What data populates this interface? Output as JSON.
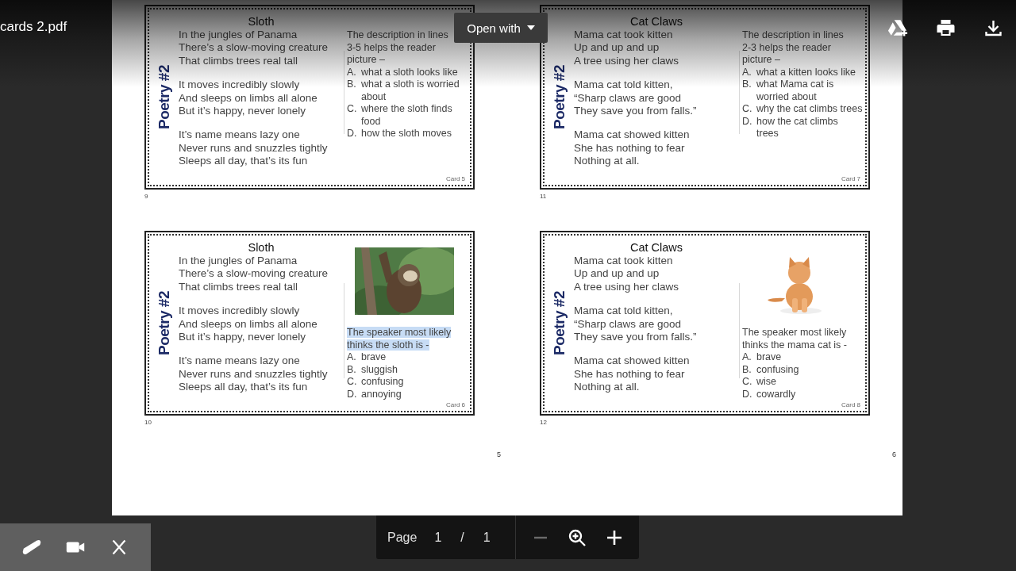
{
  "file_title": "cards 2.pdf",
  "open_with": {
    "label": "Open with"
  },
  "pages": [
    {
      "number": "5",
      "cards": [
        {
          "side_label": "Poetry #2",
          "title": "Sloth",
          "stanzas": [
            [
              "In the jungles of Panama",
              "There’s a slow-moving creature",
              "That climbs trees real tall"
            ],
            [
              "It moves incredibly slowly",
              "And sleeps on limbs all alone",
              "But it’s happy, never lonely"
            ],
            [
              "It’s name means lazy one",
              "Never runs and snuzzles tightly",
              "Sleeps all day, that’s its fun"
            ]
          ],
          "question": "The description in lines 3-5 helps the reader picture –",
          "highlighted": false,
          "options": [
            {
              "letter": "A.",
              "text": "what a sloth looks like"
            },
            {
              "letter": "B.",
              "text": "what a sloth is worried about"
            },
            {
              "letter": "C.",
              "text": "where the sloth finds food"
            },
            {
              "letter": "D.",
              "text": "how the sloth moves"
            }
          ],
          "card_label": "Card 5",
          "sheet_number": "9"
        },
        {
          "side_label": "Poetry #2",
          "title": "Sloth",
          "stanzas": [
            [
              "In the jungles of Panama",
              "There’s a slow-moving creature",
              "That climbs trees real tall"
            ],
            [
              "It moves incredibly slowly",
              "And sleeps on limbs all alone",
              "But it’s happy, never lonely"
            ],
            [
              "It’s name means lazy one",
              "Never runs and snuzzles tightly",
              "Sleeps all day, that’s its fun"
            ]
          ],
          "media": {
            "kind": "picture"
          },
          "question": "The speaker most likely thinks the sloth is -",
          "highlighted": true,
          "options": [
            {
              "letter": "A.",
              "text": "brave"
            },
            {
              "letter": "B.",
              "text": "sluggish"
            },
            {
              "letter": "C.",
              "text": "confusing"
            },
            {
              "letter": "D.",
              "text": "annoying"
            }
          ],
          "card_label": "Card 6",
          "sheet_number": "10"
        }
      ]
    },
    {
      "number": "6",
      "cards": [
        {
          "side_label": "Poetry #2",
          "title": "Cat Claws",
          "stanzas": [
            [
              "Mama cat took kitten",
              "Up and up and up",
              "A tree using her claws"
            ],
            [
              "Mama cat told kitten,",
              "“Sharp claws are good",
              "They save you from falls.”"
            ],
            [
              "Mama cat showed kitten",
              "She has nothing to fear",
              "Nothing at all."
            ]
          ],
          "question": "The description in lines 2-3 helps the reader picture –",
          "highlighted": false,
          "options": [
            {
              "letter": "A.",
              "text": "what a kitten looks like"
            },
            {
              "letter": "B.",
              "text": "what Mama cat is worried about"
            },
            {
              "letter": "C.",
              "text": "why the cat climbs trees"
            },
            {
              "letter": "D.",
              "text": "how the cat climbs trees"
            }
          ],
          "card_label": "Card 7",
          "sheet_number": "11"
        },
        {
          "side_label": "Poetry #2",
          "title": "Cat Claws",
          "stanzas": [
            [
              "Mama cat took kitten",
              "Up and up and up",
              "A tree using her claws"
            ],
            [
              "Mama cat told kitten,",
              "“Sharp claws are good",
              "They save you from falls.”"
            ],
            [
              "Mama cat showed kitten",
              "She has nothing to fear",
              "Nothing at all."
            ]
          ],
          "media": {
            "kind": "picture"
          },
          "question": "The speaker most likely thinks the mama cat is -",
          "highlighted": false,
          "options": [
            {
              "letter": "A.",
              "text": "brave"
            },
            {
              "letter": "B.",
              "text": "confusing"
            },
            {
              "letter": "C.",
              "text": "wise"
            },
            {
              "letter": "D.",
              "text": "cowardly"
            }
          ],
          "card_label": "Card 8",
          "sheet_number": "12"
        }
      ]
    }
  ],
  "page_nav": {
    "label": "Page",
    "current": "1",
    "separator": "/",
    "total": "1",
    "zoom_out_disabled": true
  }
}
